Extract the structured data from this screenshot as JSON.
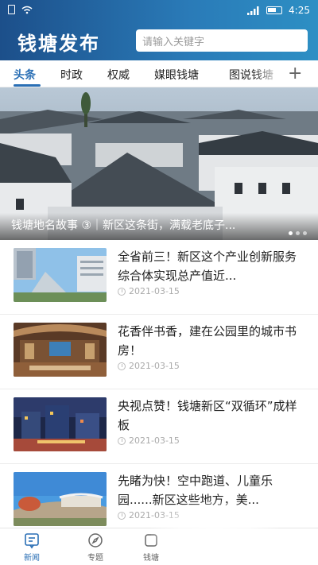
{
  "status_bar": {
    "time": "4:25",
    "icons": [
      "sim-icon",
      "wifi-icon",
      "signal-icon",
      "battery-icon"
    ]
  },
  "header": {
    "brand": "钱塘发布",
    "search_placeholder": "请输入关键字"
  },
  "tabs": [
    {
      "label": "头条",
      "active": true
    },
    {
      "label": "时政"
    },
    {
      "label": "权威"
    },
    {
      "label": "媒眼钱塘"
    },
    {
      "label": "图说钱塘"
    }
  ],
  "banner": {
    "caption": "钱塘地名故事 ③｜新区这条街，满载老底子...",
    "slides": 3,
    "active_slide": 1
  },
  "news": [
    {
      "title": "全省前三！新区这个产业创新服务综合体实现总产值近...",
      "date": "2021-03-15"
    },
    {
      "title": "花香伴书香，建在公园里的城市书房！",
      "date": "2021-03-15"
    },
    {
      "title": "央视点赞！钱塘新区“双循环”成样板",
      "date": "2021-03-15"
    },
    {
      "title": "先睹为快！空中跑道、儿童乐园......新区这些地方，美...",
      "date": "2021-03-15"
    }
  ],
  "bottom_nav": [
    {
      "label": "新闻",
      "icon": "news-icon",
      "active": true
    },
    {
      "label": "专题",
      "icon": "compass-icon"
    },
    {
      "label": "钱塘",
      "icon": "qiantang-icon"
    },
    {
      "label": "",
      "icon": ""
    }
  ],
  "colors": {
    "header_start": "#1c4f8a",
    "header_end": "#2d8fc4",
    "accent": "#2a6fb5"
  }
}
